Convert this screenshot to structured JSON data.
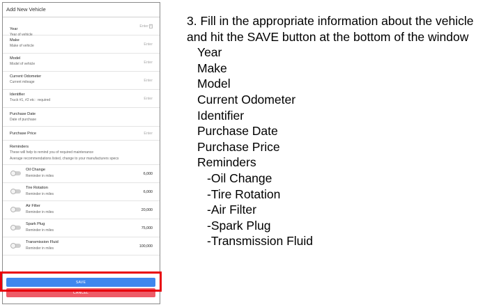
{
  "form": {
    "title": "Add New Vehicle",
    "fields": [
      {
        "label": "Year",
        "sublabel": "Year of vehicle",
        "placeholder": "Enter"
      },
      {
        "label": "Make",
        "sublabel": "Make of vehicle",
        "placeholder": "Enter"
      },
      {
        "label": "Model",
        "sublabel": "Model of vehicle",
        "placeholder": "Enter"
      },
      {
        "label": "Current Odometer",
        "sublabel": "Current mileage",
        "placeholder": "Enter"
      },
      {
        "label": "Identifier",
        "sublabel": "Truck #1, #2 etc : required",
        "placeholder": "Enter"
      },
      {
        "label": "Purchase Date",
        "sublabel": "Date of purchase"
      },
      {
        "label": "Purchase Price",
        "placeholder": "Enter"
      }
    ],
    "reminders": {
      "label": "Reminders",
      "desc1": "These will help to remind you of required maintenance",
      "desc2": "Average recommendations listed, change to your manufacturers specs",
      "items": [
        {
          "label": "Oil Change",
          "sublabel": "Reminder in miles",
          "value": "6,000"
        },
        {
          "label": "Tire Rotation",
          "sublabel": "Reminder in miles",
          "value": "6,000"
        },
        {
          "label": "Air Filter",
          "sublabel": "Reminder in miles",
          "value": "20,000"
        },
        {
          "label": "Spark Plug",
          "sublabel": "Reminder in miles",
          "value": "75,000"
        },
        {
          "label": "Transmission Fluid",
          "sublabel": "Reminder in miles",
          "value": "100,000"
        }
      ]
    },
    "save_label": "SAVE",
    "cancel_label": "CANCEL",
    "colors": {
      "save": "#3f87ee",
      "cancel": "#ee5b66",
      "highlight": "#e8000b"
    }
  },
  "instructions": {
    "line1": "3. Fill in the appropriate information about the vehicle",
    "line2": "and hit the SAVE button at the bottom of the window",
    "items": [
      "Year",
      "Make",
      "Model",
      "Current Odometer",
      "Identifier",
      "Purchase Date",
      "Purchase Price",
      "Reminders"
    ],
    "subitems": [
      "-Oil Change",
      "-Tire Rotation",
      "-Air Filter",
      "-Spark Plug",
      "-Transmission Fluid"
    ]
  }
}
